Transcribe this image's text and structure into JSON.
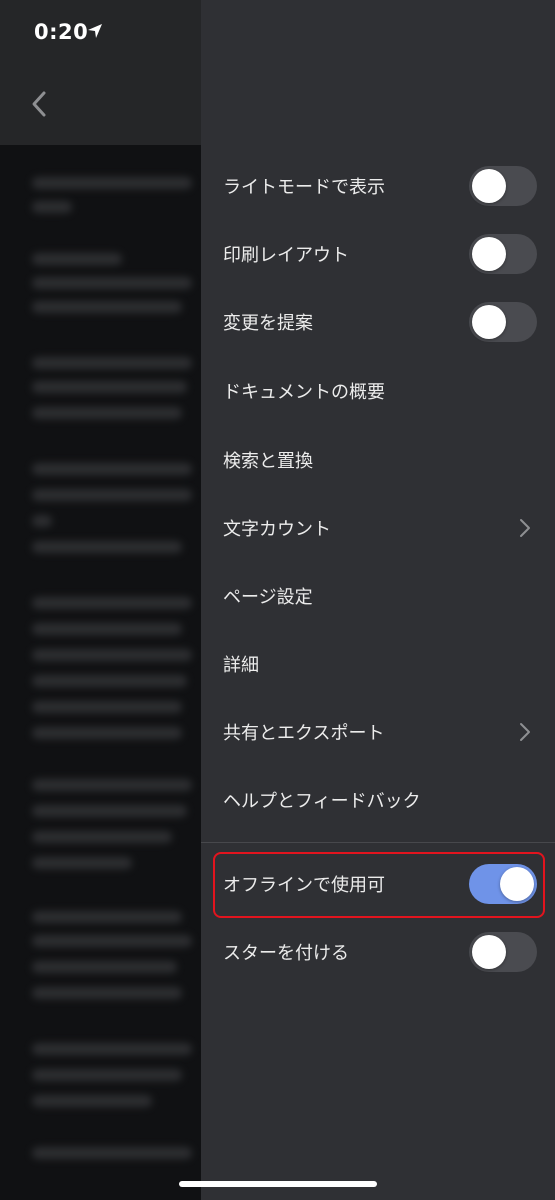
{
  "status_bar": {
    "time": "0:20",
    "icons": [
      "location-arrow-icon",
      "cellular-signal-icon",
      "wifi-icon",
      "battery-charging-icon"
    ],
    "battery_color": "#4cd964"
  },
  "drawer": {
    "title": "",
    "items": [
      {
        "label": "ライトモードで表示",
        "control": "toggle",
        "on": false
      },
      {
        "label": "印刷レイアウト",
        "control": "toggle",
        "on": false
      },
      {
        "label": "変更を提案",
        "control": "toggle",
        "on": false
      },
      {
        "label": "ドキュメントの概要",
        "control": "none"
      },
      {
        "label": "検索と置換",
        "control": "none"
      },
      {
        "label": "文字カウント",
        "control": "chevron-right-icon"
      },
      {
        "label": "ページ設定",
        "control": "none"
      },
      {
        "label": "詳細",
        "control": "none"
      },
      {
        "label": "共有とエクスポート",
        "control": "chevron-right-icon"
      },
      {
        "label": "ヘルプとフィードバック",
        "control": "none"
      },
      {
        "label": "オフラインで使用可",
        "control": "toggle",
        "on": true,
        "highlighted": true
      },
      {
        "label": "スターを付ける",
        "control": "toggle",
        "on": false
      }
    ]
  },
  "colors": {
    "drawer_bg": "#2f3034",
    "toggle_on": "#6f93e8",
    "toggle_off": "#4a4b50",
    "highlight": "#e2141e"
  }
}
